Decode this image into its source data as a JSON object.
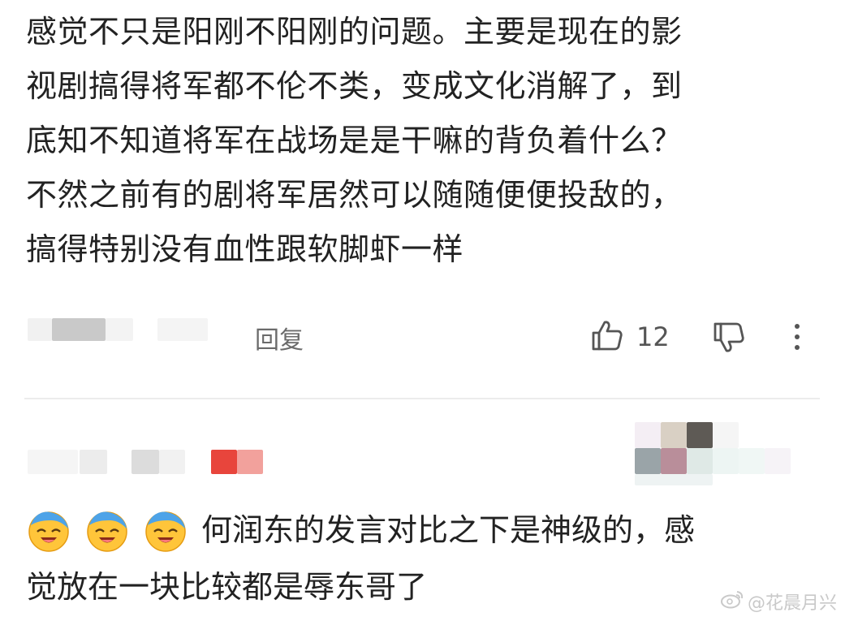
{
  "comment1": {
    "lines": [
      "感觉不只是阳刚不阳刚的问题。主要是现在的影",
      "视剧搞得将军都不伦不类，变成文化消解了，到",
      "底知不知道将军在战场是是干嘛的背负着什么？",
      "不然之前有的剧将军居然可以随随便便投敌的，",
      "搞得特别没有血性跟软脚虾一样"
    ],
    "reply_label": "回复",
    "like_count": "12",
    "icons": {
      "like": "thumbs-up-icon",
      "dislike": "thumbs-down-icon",
      "more": "more-vertical-icon"
    }
  },
  "comment2": {
    "emoji_count": 3,
    "emoji_icon": "laugh-cry-emoji-icon",
    "line1": "何润东的发言对比之下是神级的，感",
    "line2": "觉放在一块比较都是辱东哥了"
  },
  "watermark": {
    "text": "@花晨月兴",
    "icon": "weibo-icon"
  },
  "colors": {
    "text": "#222222",
    "secondary": "#6b6b6b",
    "divider": "#ececec",
    "accent_red": "#e8453c"
  }
}
